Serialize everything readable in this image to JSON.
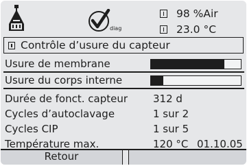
{
  "header": {
    "status": [
      {
        "value": "98 %Air"
      },
      {
        "value": "23.0 °C"
      }
    ],
    "logo_icon": "sensor-flask-icon",
    "diag_icon": "diag-checkmark-icon",
    "diag_label": "diag"
  },
  "title": "Contrôle d’usure du capteur",
  "wear": [
    {
      "label": "Usure de membrane",
      "level": 0.82
    },
    {
      "label": "Usure du corps interne",
      "level": 0.14
    }
  ],
  "details": [
    {
      "label": "Durée de fonct. capteur",
      "value": "312 d",
      "date": ""
    },
    {
      "label": "Cycles d’autoclavage",
      "value": "1 sur 2",
      "date": ""
    },
    {
      "label": "Cycles CIP",
      "value": "1 sur 5",
      "date": ""
    },
    {
      "label": "Température max.",
      "value": "120 °C",
      "date": "01.10.05"
    }
  ],
  "softkeys": {
    "left": "Retour",
    "right": ""
  },
  "colors": {
    "background": "#e6e7e9",
    "ink": "#1e1e1e",
    "softkey": "#d3d5d9"
  }
}
